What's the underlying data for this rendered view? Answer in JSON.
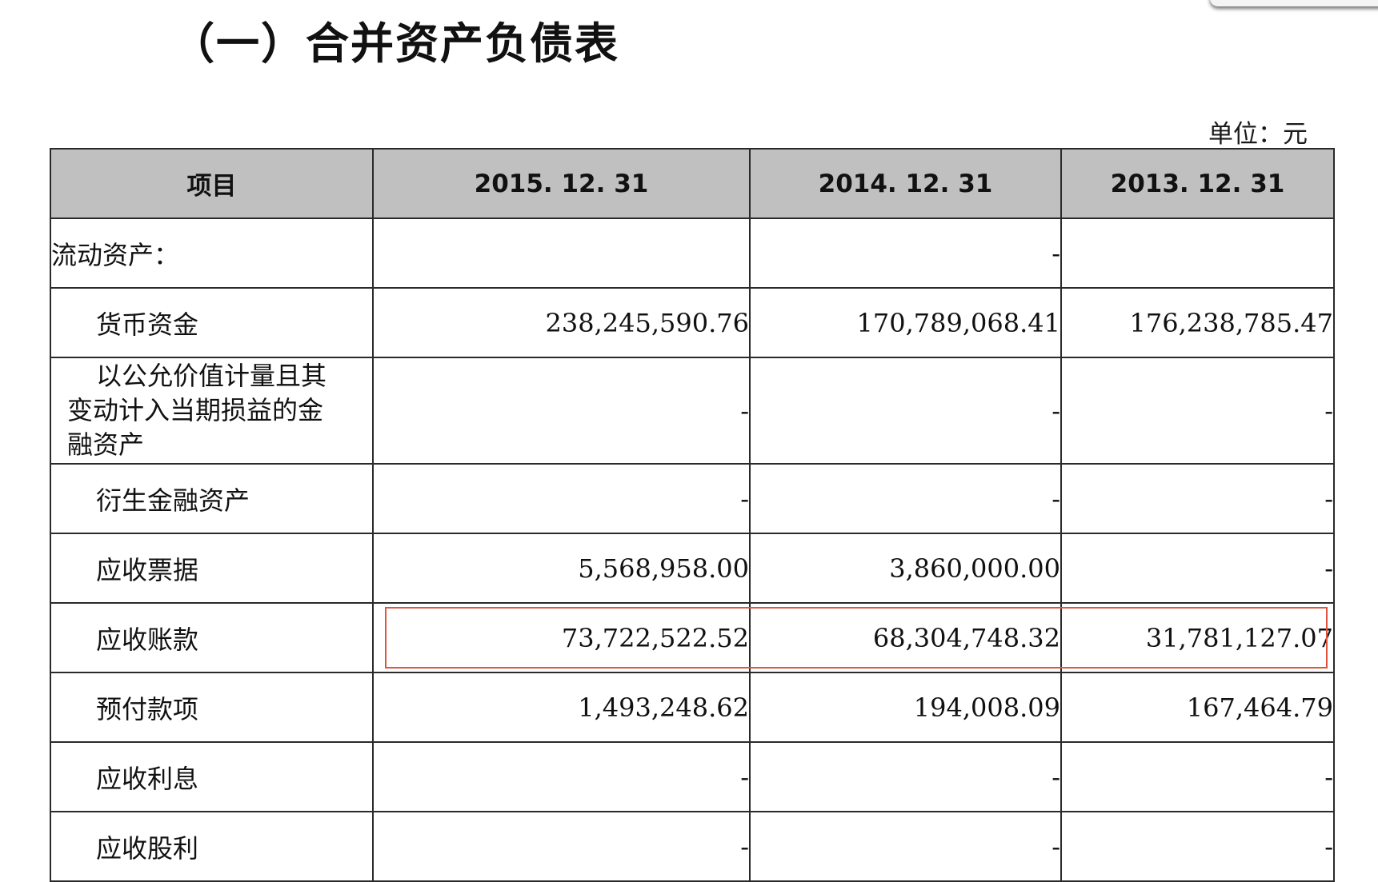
{
  "title": "（一）合并资产负债表",
  "unit_label": "单位：元",
  "table": {
    "headers": [
      "项目",
      "2015. 12. 31",
      "2014. 12. 31",
      "2013. 12. 31"
    ],
    "rows": [
      {
        "item": "流动资产：",
        "v2015": "",
        "v2014": "-",
        "v2013": ""
      },
      {
        "item": "货币资金",
        "v2015": "238,245,590.76",
        "v2014": "170,789,068.41",
        "v2013": "176,238,785.47"
      },
      {
        "item_lines": [
          "以公允价值计量且其",
          "变动计入当期损益的金",
          "融资产"
        ],
        "v2015": "-",
        "v2014": "-",
        "v2013": "-"
      },
      {
        "item": "衍生金融资产",
        "v2015": "-",
        "v2014": "-",
        "v2013": "-"
      },
      {
        "item": "应收票据",
        "v2015": "5,568,958.00",
        "v2014": "3,860,000.00",
        "v2013": "-"
      },
      {
        "item": "应收账款",
        "v2015": "73,722,522.52",
        "v2014": "68,304,748.32",
        "v2013": "31,781,127.07"
      },
      {
        "item": "预付款项",
        "v2015": "1,493,248.62",
        "v2014": "194,008.09",
        "v2013": "167,464.79"
      },
      {
        "item": "应收利息",
        "v2015": "-",
        "v2014": "-",
        "v2013": "-"
      },
      {
        "item": "应收股利",
        "v2015": "-",
        "v2014": "-",
        "v2013": "-"
      }
    ]
  },
  "colors": {
    "header_bg": "#c0c0c0",
    "highlight_border": "#e05540"
  }
}
